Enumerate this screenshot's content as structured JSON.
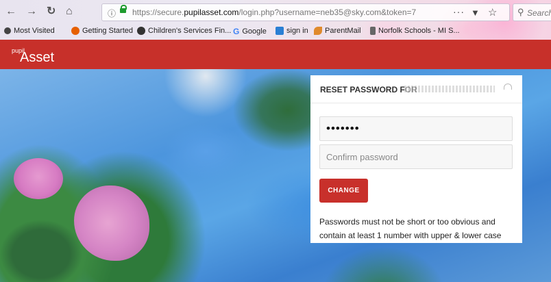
{
  "browser": {
    "url_text": "https://secure.pupilasset.com/login.php?username=neb35@sky.com&token=7",
    "url_domain_highlight": "pupilasset.com",
    "search_placeholder": "Search",
    "menu_dots": "···",
    "icons": [
      "back-icon",
      "forward-icon",
      "reload-icon",
      "home-icon",
      "info-icon",
      "lock-icon",
      "pocket-icon",
      "star-icon",
      "search-icon"
    ]
  },
  "bookmarks": [
    {
      "label": "Most Visited",
      "icon": "gear-icon",
      "color": "#333333"
    },
    {
      "label": "Getting Started",
      "icon": "firefox-icon",
      "color": "#e66000"
    },
    {
      "label": "Children's Services Fin...",
      "icon": "globe-icon",
      "color": "#333333"
    },
    {
      "label": "Google",
      "icon": "google-icon",
      "color": "#4285f4"
    },
    {
      "label": "sign in",
      "icon": "sign-in-icon",
      "color": "#2a7fd4"
    },
    {
      "label": "ParentMail",
      "icon": "parentmail-icon",
      "color": "#e08a2c"
    },
    {
      "label": "Norfolk Schools - MI S...",
      "icon": "norfolk-icon",
      "color": "#555555"
    }
  ],
  "app": {
    "logo_small": "pupil",
    "logo_big": "Asset",
    "brand_color": "#c7302a"
  },
  "reset": {
    "title": "RESET PASSWORD FOR",
    "password_value": "•••••••",
    "confirm_placeholder": "Confirm password",
    "button_label": "CHANGE",
    "help_text": "Passwords must not be short or too obvious and contain at least 1 number with upper & lower case"
  }
}
